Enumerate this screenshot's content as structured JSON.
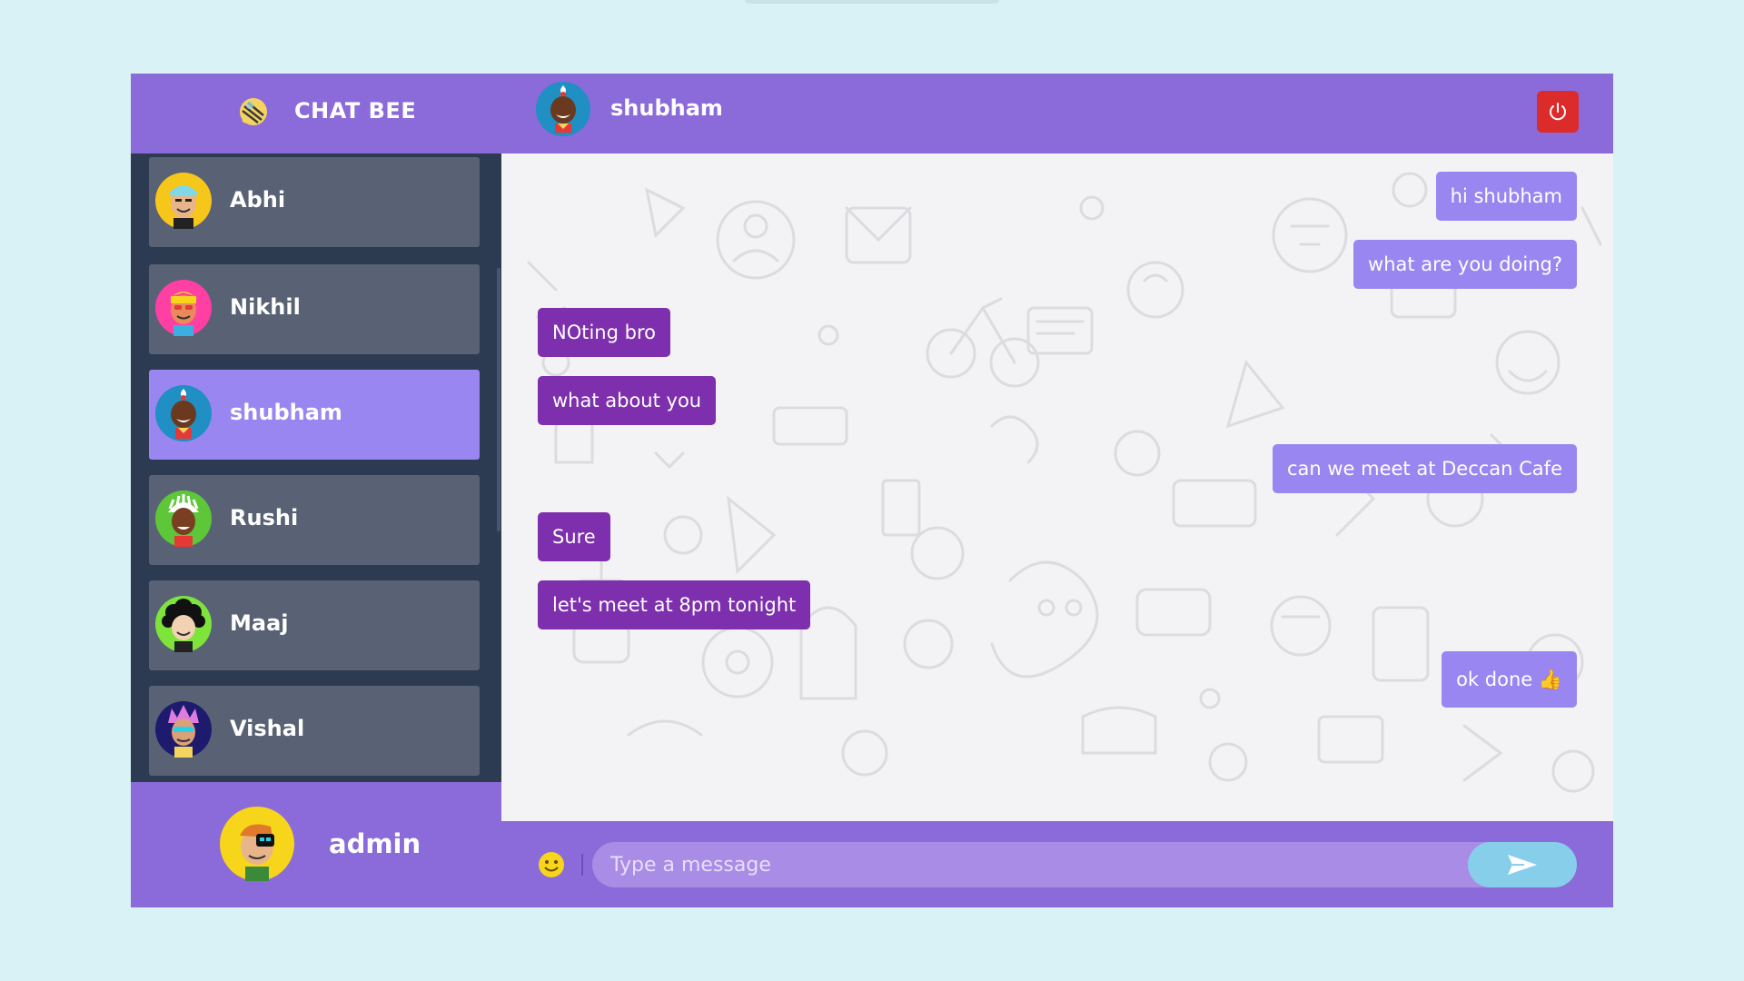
{
  "app": {
    "name": "CHAT BEE"
  },
  "header": {
    "contact_name": "shubham"
  },
  "contacts": [
    {
      "name": "Abhi"
    },
    {
      "name": "Nikhil"
    },
    {
      "name": "shubham"
    },
    {
      "name": "Rushi"
    },
    {
      "name": "Maaj"
    },
    {
      "name": "Vishal"
    }
  ],
  "active_contact": "shubham",
  "current_user": {
    "name": "admin"
  },
  "messages": [
    {
      "text": "hi shubham",
      "direction": "outgoing"
    },
    {
      "text": "what are you doing?",
      "direction": "outgoing"
    },
    {
      "text": "NOting bro",
      "direction": "incoming"
    },
    {
      "text": "what about you",
      "direction": "incoming"
    },
    {
      "text": "can we meet at Deccan Cafe",
      "direction": "outgoing"
    },
    {
      "text": "Sure",
      "direction": "incoming"
    },
    {
      "text": "let's meet at 8pm tonight",
      "direction": "incoming"
    },
    {
      "text": "ok done 👍",
      "direction": "outgoing"
    }
  ],
  "composer": {
    "placeholder": "Type a message"
  },
  "colors": {
    "accent": "#8b6ad9",
    "outgoing_bubble": "#9a86f0",
    "incoming_bubble": "#7d2fad",
    "sidebar": "#2c3a52",
    "logout": "#dc2b2b",
    "send": "#87ceeb"
  },
  "icons": [
    "chat-bee-logo",
    "power-icon",
    "emoji-icon",
    "send-icon"
  ]
}
